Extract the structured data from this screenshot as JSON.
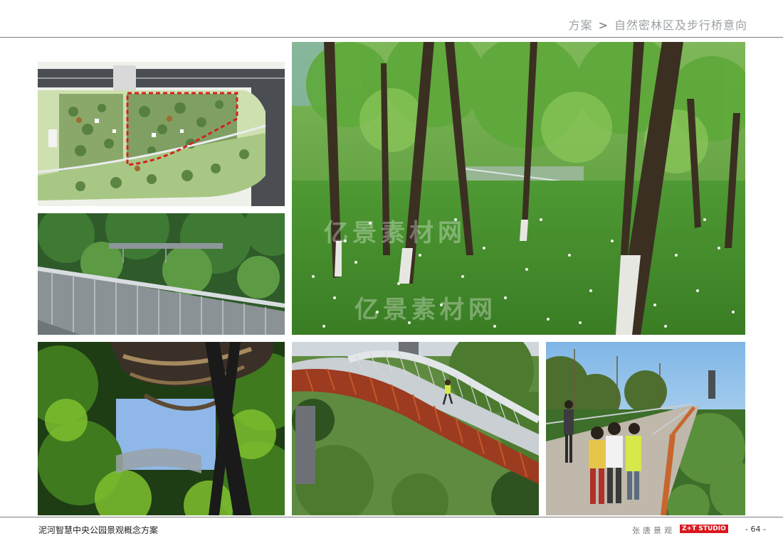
{
  "header": {
    "section": "方案",
    "arrow": ">",
    "title": "自然密林区及步行桥意向"
  },
  "footer": {
    "project": "泥河智慧中央公园景观概念方案",
    "studio_cn": "张唐景观",
    "studio_badge": "Z+T STUDIO",
    "page": "- 64 -"
  },
  "watermark": {
    "text": "亿景素材网"
  },
  "colors": {
    "rule": "#7c7c7c",
    "header_text": "#9aa0a4",
    "badge_red": "#d7191f",
    "plan_redline": "#d62020"
  }
}
